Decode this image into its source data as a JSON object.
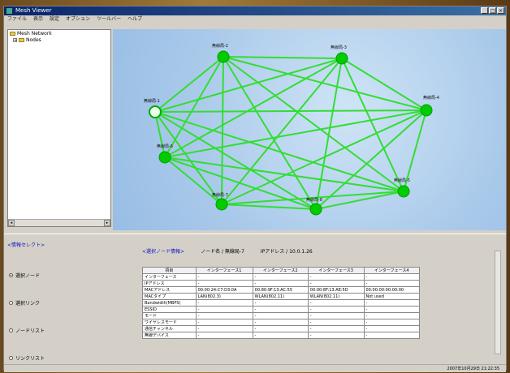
{
  "window": {
    "title": "Mesh Viewer"
  },
  "menu": [
    "ファイル",
    "表示",
    "設定",
    "オプション",
    "ツールバー",
    "ヘルプ"
  ],
  "tree": {
    "root": "Mesh Network",
    "child": "Nodes"
  },
  "graph": {
    "nodes": [
      {
        "id": "n1",
        "label": "無線局-1",
        "selected": true
      },
      {
        "id": "n2",
        "label": "無線局-2",
        "selected": false
      },
      {
        "id": "n3",
        "label": "無線局-3",
        "selected": false
      },
      {
        "id": "n4",
        "label": "無線局-4",
        "selected": false
      },
      {
        "id": "n5",
        "label": "無線局-5",
        "selected": false
      },
      {
        "id": "n6",
        "label": "無線局-6",
        "selected": false
      },
      {
        "id": "n7",
        "label": "無線局-7",
        "selected": false
      },
      {
        "id": "n8",
        "label": "無線局-8",
        "selected": false
      }
    ],
    "link_color": "#33dd33",
    "node_color": "#00cc00"
  },
  "left_panel": {
    "header": "<情報セレクト>",
    "options": [
      {
        "label": "選択ノード",
        "checked": true
      },
      {
        "label": "選択リンク",
        "checked": false
      },
      {
        "label": "ノードリスト",
        "checked": false
      },
      {
        "label": "リンクリスト",
        "checked": false
      }
    ]
  },
  "info": {
    "section": "<選択ノード情報>",
    "node": "ノード名 / 無線局-7",
    "ip": "IPアドレス / 10.0.1.26"
  },
  "table": {
    "headers": [
      "項目",
      "インターフェース1",
      "インターフェース2",
      "インターフェース3",
      "インターフェース4"
    ],
    "rows": [
      [
        "インターフェース",
        "-",
        "-",
        "-",
        "-"
      ],
      [
        "IPアドレス",
        "-",
        "-",
        "-",
        "-"
      ],
      [
        "MACアドレス",
        "00:00:24:C7:D3:0A",
        "00:80:9F:13:AC:55",
        "00:00:8F:13:AE:5D",
        "00:00:00:00:00:00"
      ],
      [
        "MACタイプ",
        "LAN(802.3)",
        "WLAN(802.11)",
        "WLAN(802.11)",
        "Not used"
      ],
      [
        "Bandwidth(MBPS)",
        "-",
        "-",
        "-",
        "-"
      ],
      [
        "ESSID",
        "-",
        "-",
        "-",
        "-"
      ],
      [
        "モード",
        "-",
        "-",
        "-",
        "-"
      ],
      [
        "ワイヤレスモード",
        "-",
        "-",
        "-",
        "-"
      ],
      [
        "通信チャンネル",
        "-",
        "-",
        "-",
        "-"
      ],
      [
        "無線デバイス",
        "-",
        "-",
        "-",
        "-"
      ]
    ]
  },
  "status": "2007年10月29日 21:22:35"
}
